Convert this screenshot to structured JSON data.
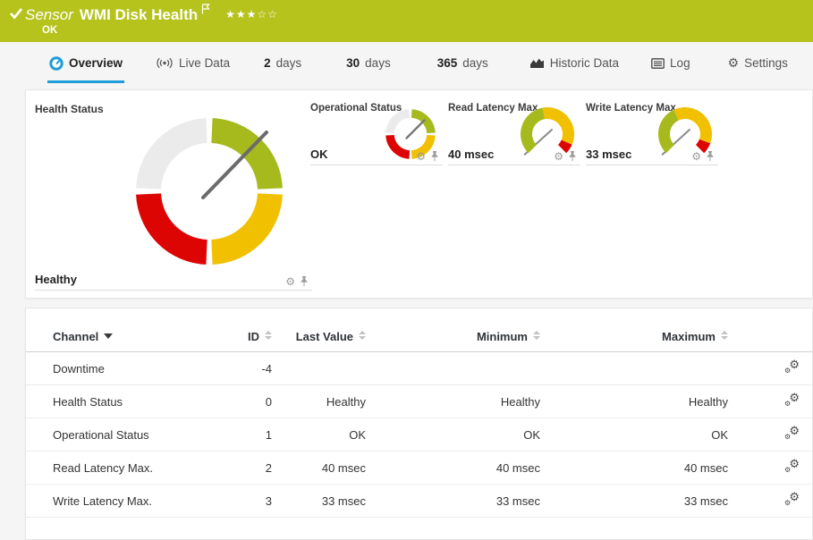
{
  "header": {
    "kind_label": "Sensor",
    "title": "WMI Disk Health",
    "status": "OK",
    "stars_filled": "★★★",
    "stars_empty": "☆☆"
  },
  "tabs": [
    {
      "strong": "Overview",
      "rest": "",
      "active": true
    },
    {
      "strong": "",
      "rest": "Live Data"
    },
    {
      "strong": "2",
      "rest": "days"
    },
    {
      "strong": "30",
      "rest": "days"
    },
    {
      "strong": "365",
      "rest": "days"
    },
    {
      "strong": "",
      "rest": "Historic Data"
    },
    {
      "strong": "",
      "rest": "Log"
    },
    {
      "strong": "",
      "rest": "Settings"
    }
  ],
  "gauges": {
    "main": {
      "title": "Health Status",
      "value": "Healthy"
    },
    "tiles": [
      {
        "title": "Operational Status",
        "value": "OK"
      },
      {
        "title": "Read Latency Max.",
        "value": "40 msec"
      },
      {
        "title": "Write Latency Max.",
        "value": "33 msec"
      }
    ],
    "segment_colors": {
      "ok": "#a6ba1e",
      "warning": "#f1c000",
      "error": "#dd0404",
      "none": "#ebebeb",
      "needle": "#6b6b6b"
    }
  },
  "table": {
    "headers": [
      {
        "label": "Channel",
        "sort": "desc"
      },
      {
        "label": "ID",
        "sort": "both"
      },
      {
        "label": "Last Value",
        "sort": "both"
      },
      {
        "label": "Minimum",
        "sort": "both"
      },
      {
        "label": "Maximum",
        "sort": "both"
      }
    ],
    "rows": [
      {
        "channel": "Downtime",
        "id": "-4",
        "last": "",
        "min": "",
        "max": ""
      },
      {
        "channel": "Health Status",
        "id": "0",
        "last": "Healthy",
        "min": "Healthy",
        "max": "Healthy"
      },
      {
        "channel": "Operational Status",
        "id": "1",
        "last": "OK",
        "min": "OK",
        "max": "OK"
      },
      {
        "channel": "Read Latency Max.",
        "id": "2",
        "last": "40 msec",
        "min": "40 msec",
        "max": "40 msec"
      },
      {
        "channel": "Write Latency Max.",
        "id": "3",
        "last": "33 msec",
        "min": "33 msec",
        "max": "33 msec"
      }
    ]
  },
  "icons": {
    "gear": "⚙"
  },
  "colors": {
    "header_green": "#b6c31d",
    "accent_blue": "#1e9dd8"
  }
}
